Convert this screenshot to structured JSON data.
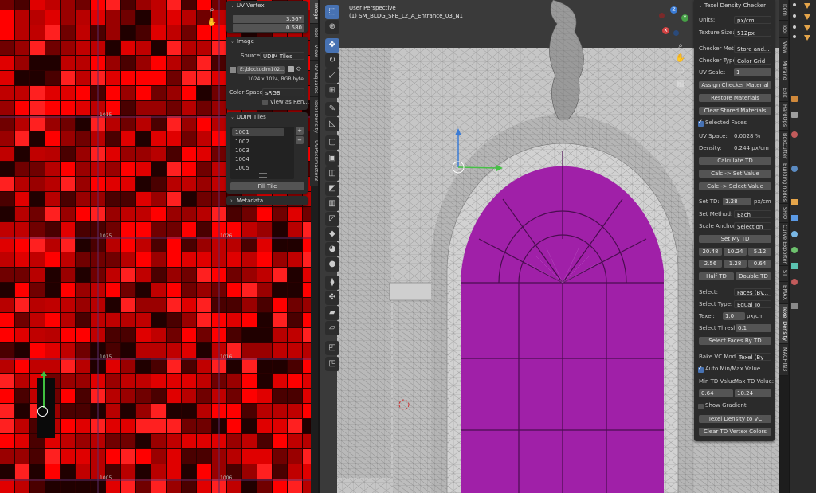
{
  "uv_editor": {
    "tile_labels": [
      "1015",
      "1025",
      "1026",
      "1015",
      "1016",
      "1005",
      "1006"
    ],
    "vertical_tabs": [
      "Image",
      "Tool",
      "View",
      "UV Squares",
      "Texel Density",
      "UVPackmaster3"
    ],
    "uv_vertex_panel": {
      "title": "UV Vertex",
      "x_label": "X",
      "x_value": "3.567",
      "y_label": "Y",
      "y_value": "0.580"
    },
    "image_panel": {
      "title": "Image",
      "source_label": "Source",
      "source_value": "UDIM Tiles",
      "filepath": "E:\\blockudim102...",
      "info": "1024 x 1024,  RGB byte",
      "color_space_label": "Color Space",
      "color_space_value": "sRGB",
      "view_as_render": "View as Ren..."
    },
    "udim_panel": {
      "title": "UDIM Tiles",
      "tiles": [
        "1001",
        "1002",
        "1003",
        "1004",
        "1005"
      ],
      "fill_button": "Fill Tile"
    },
    "metadata_panel": {
      "title": "Metadata"
    }
  },
  "viewport": {
    "view_name": "User Perspective",
    "object_name": "(1) SM_BLDG_SFB_L2_A_Entrance_03_N1",
    "gizmo_labels": {
      "z": "Z",
      "y": "Y",
      "x": "X"
    },
    "colors": {
      "selected_face": "#a020a8",
      "mesh_bg": "#c6c6c6",
      "wire": "#555555"
    }
  },
  "texel_panel": {
    "title": "Texel Density Checker",
    "units_label": "Units:",
    "units_value": "px/cm",
    "texture_size_label": "Texture Size:",
    "texture_size_value": "512px",
    "checker_method_label": "Checker Met...",
    "checker_method_value": "Store and...",
    "checker_type_label": "Checker Type:",
    "checker_type_value": "Color Grid",
    "uv_scale_label": "UV Scale:",
    "uv_scale_value": "1",
    "assign_checker": "Assign Checker Material",
    "restore_materials": "Restore Materials",
    "clear_stored": "Clear Stored Materials",
    "selected_faces": "Selected Faces",
    "uv_space_label": "UV Space:",
    "uv_space_value": "0.0028 %",
    "density_label": "Density:",
    "density_value": "0.244 px/cm",
    "calculate_td": "Calculate TD",
    "calc_set": "Calc -> Set Value",
    "calc_select": "Calc -> Select Value",
    "set_td_label": "Set TD:",
    "set_td_value": "1.28",
    "set_td_unit": "px/cm",
    "set_method_label": "Set Method:",
    "set_method_value": "Each",
    "scale_anchor_label": "Scale Anchor:",
    "scale_anchor_value": "Selection",
    "set_my_td": "Set My TD",
    "presets_row1": [
      "20.48",
      "10.24",
      "5.12"
    ],
    "presets_row2": [
      "2.56",
      "1.28",
      "0.64"
    ],
    "half_td": "Half TD",
    "double_td": "Double TD",
    "select_label": "Select:",
    "select_value": "Faces (By...",
    "select_type_label": "Select Type:",
    "select_type_value": "Equal To",
    "texel_label": "Texel:",
    "texel_value": "1.0",
    "texel_unit": "px/cm",
    "select_thresh_label": "Select Thresh",
    "select_thresh_value": "0.1",
    "select_faces_by_td": "Select Faces By TD",
    "bake_vc_label": "Bake VC Mod...",
    "bake_vc_value": "Texel (By",
    "auto_minmax": "Auto Min/Max Value",
    "min_td_label": "Min TD Value:",
    "max_td_label": "Max TD Value:",
    "min_td_value": "0.64",
    "max_td_value": "10.24",
    "show_gradient": "Show Gradient",
    "texel_to_vc": "Texel Density to VC",
    "clear_vc": "Clear TD Vertex Colors"
  },
  "viewport_tabs": [
    "Item",
    "Tool",
    "View",
    "Mirrano",
    "Edit",
    "HardOps",
    "BoxCutter",
    "Building nodes",
    "SPIO",
    "Curve Exporter",
    "ST",
    "BMAX",
    "Texel Density",
    "MACHIN3"
  ]
}
